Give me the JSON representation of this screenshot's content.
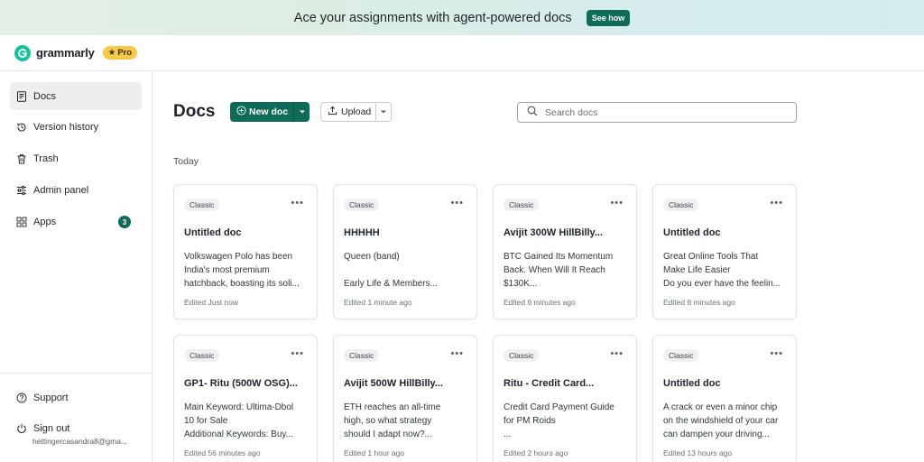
{
  "banner": {
    "text": "Ace your assignments with agent-powered docs",
    "cta": "See how"
  },
  "brand": {
    "name": "grammarly",
    "plan": "Pro",
    "accent": "#0e6b57",
    "logo_color": "#15c39a"
  },
  "sidebar": {
    "items": [
      {
        "label": "Docs",
        "icon": "docs-icon",
        "active": true
      },
      {
        "label": "Version history",
        "icon": "history-icon"
      },
      {
        "label": "Trash",
        "icon": "trash-icon"
      },
      {
        "label": "Admin panel",
        "icon": "sliders-icon"
      },
      {
        "label": "Apps",
        "icon": "apps-grid-icon",
        "badge": "3"
      }
    ],
    "footer": [
      {
        "label": "Support",
        "icon": "help-icon"
      },
      {
        "label": "Sign out",
        "icon": "power-icon"
      }
    ],
    "account_email": "hettingercasandra8@gma..."
  },
  "main": {
    "title": "Docs",
    "new_doc_label": "New doc",
    "upload_label": "Upload",
    "search_placeholder": "Search docs",
    "section_label": "Today",
    "cards": [
      {
        "tag": "Classic",
        "title": "Untitled doc",
        "snippet": "Volkswagen Polo has been\nIndia's most premium\nhatchback, boasting its soli...",
        "edited": "Edited Just now"
      },
      {
        "tag": "Classic",
        "title": "HHHHH",
        "snippet": "Queen (band)\n\nEarly Life & Members...",
        "edited": "Edited 1 minute ago"
      },
      {
        "tag": "Classic",
        "title": "Avijit 300W HillBilly...",
        "snippet": "BTC Gained Its Momentum\nBack. When Will It Reach\n$130K...",
        "edited": "Edited 6 minutes ago"
      },
      {
        "tag": "Classic",
        "title": "Untitled doc",
        "snippet": "Great Online Tools That\nMake Life Easier\nDo you ever have the feelin...",
        "edited": "Edited 6 minutes ago"
      },
      {
        "tag": "Classic",
        "title": "GP1- Ritu (500W OSG)...",
        "snippet": "Main Keyword: Ultima-Dbol\n10 for Sale\nAdditional Keywords: Buy...",
        "edited": "Edited 56 minutes ago"
      },
      {
        "tag": "Classic",
        "title": "Avijit 500W HillBilly...",
        "snippet": "ETH reaches an all-time\nhigh, so what strategy\nshould I adapt now?...",
        "edited": "Edited 1 hour ago"
      },
      {
        "tag": "Classic",
        "title": "Ritu - Credit Card...",
        "snippet": "Credit Card Payment Guide\nfor PM Roids\n...",
        "edited": "Edited 2 hours ago"
      },
      {
        "tag": "Classic",
        "title": "Untitled doc",
        "snippet": "A crack or even a minor chip\non the windshield of your car\ncan dampen your driving...",
        "edited": "Edited 13 hours ago"
      }
    ]
  }
}
